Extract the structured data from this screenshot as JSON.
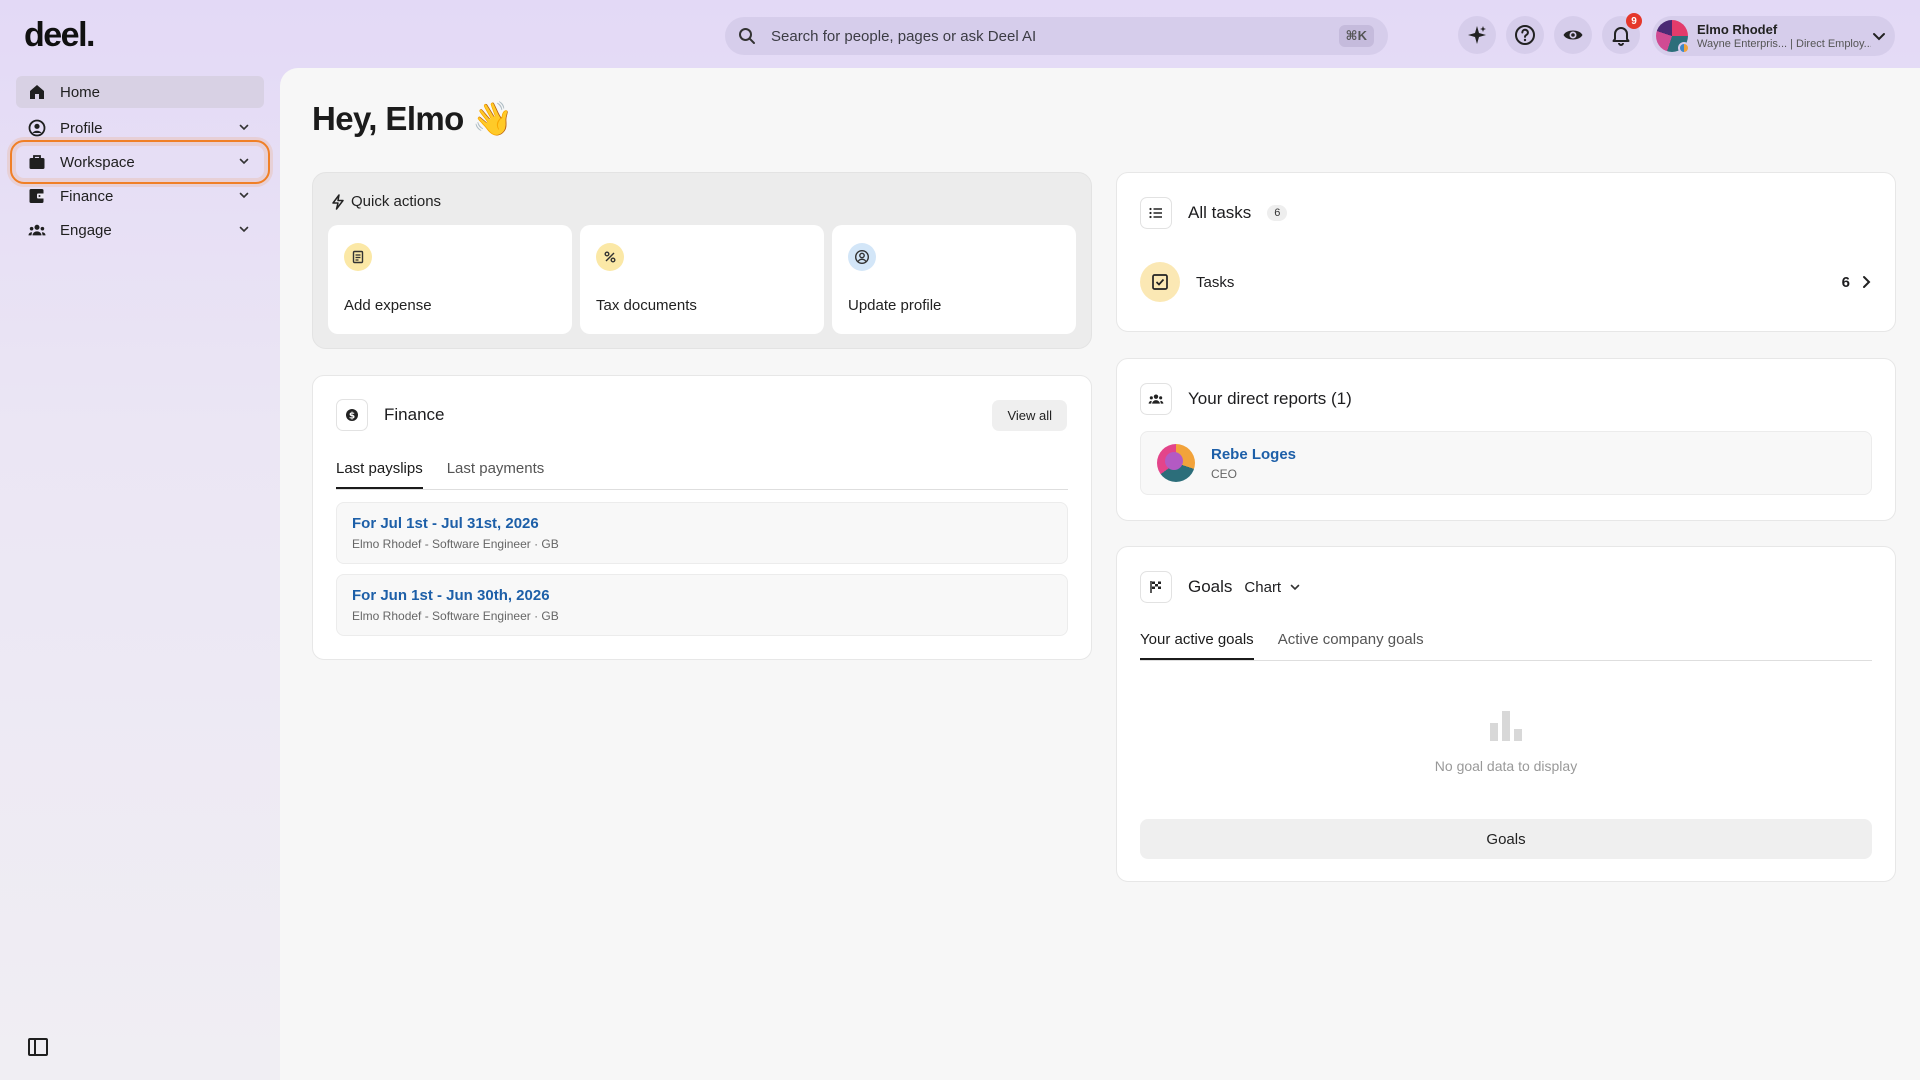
{
  "app": {
    "logo": "deel."
  },
  "search": {
    "placeholder": "Search for people, pages or ask Deel AI",
    "shortcut": "⌘K"
  },
  "topbar": {
    "notification_count": "9"
  },
  "user": {
    "name": "Elmo Rhodef",
    "subtitle": "Wayne Enterpris... | Direct Employ..."
  },
  "sidebar": {
    "items": [
      {
        "label": "Home",
        "icon": "home-icon",
        "active": true
      },
      {
        "label": "Profile",
        "icon": "profile-icon"
      },
      {
        "label": "Workspace",
        "icon": "briefcase-icon",
        "highlighted": true
      },
      {
        "label": "Finance",
        "icon": "wallet-icon"
      },
      {
        "label": "Engage",
        "icon": "people-icon"
      }
    ]
  },
  "main": {
    "greeting": "Hey, Elmo 👋",
    "quick_actions": {
      "title": "Quick actions",
      "items": [
        {
          "label": "Add expense",
          "icon": "receipt-icon",
          "color": "#fbe8a6"
        },
        {
          "label": "Tax documents",
          "icon": "percent-icon",
          "color": "#fbe8a6"
        },
        {
          "label": "Update profile",
          "icon": "user-circle-icon",
          "color": "#d3e6f8"
        }
      ]
    },
    "finance": {
      "title": "Finance",
      "view_all": "View all",
      "tabs": [
        "Last payslips",
        "Last payments"
      ],
      "payslips": [
        {
          "title": "For Jul 1st - Jul 31st, 2026",
          "subtitle": "Elmo Rhodef - Software Engineer · GB"
        },
        {
          "title": "For Jun 1st - Jun 30th, 2026",
          "subtitle": "Elmo Rhodef - Software Engineer · GB"
        }
      ]
    },
    "tasks": {
      "title": "All tasks",
      "count": "6",
      "row_label": "Tasks",
      "row_count": "6"
    },
    "reports": {
      "title": "Your direct reports (1)",
      "person_name": "Rebe Loges",
      "person_role": "CEO"
    },
    "goals": {
      "title": "Goals",
      "view_select": "Chart",
      "tabs": [
        "Your active goals",
        "Active company goals"
      ],
      "empty_text": "No goal data to display",
      "button": "Goals"
    }
  },
  "colors": {
    "accent_link": "#1d5fa8",
    "highlight_outline": "#f07f26",
    "badge": "#e5372b"
  }
}
